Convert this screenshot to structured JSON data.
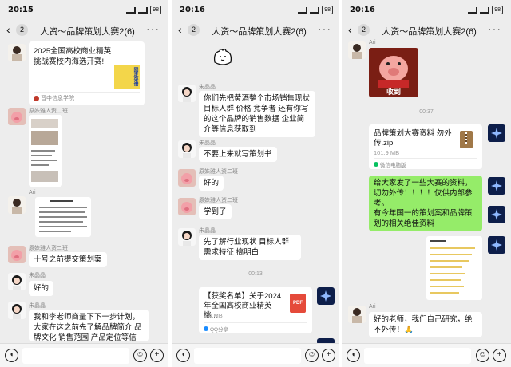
{
  "status_bar": {
    "times": [
      "20:15",
      "20:16",
      "20:16"
    ],
    "battery": "98"
  },
  "nav": {
    "back_count": "2",
    "title": "人资～品牌策划大赛2(6)"
  },
  "senders": {
    "pig": "原姝雅人资二班",
    "ai": "Ari",
    "girl": "朱晶晶"
  },
  "screen1": {
    "card": {
      "title": "2025全国高校商业精英挑战赛校内海选开赛!",
      "source": "晋中信息学院",
      "thumb_text": "固定菜谱"
    },
    "bubble1": "十号之前提交策划案",
    "bubble2": "好的",
    "bubble3": "我和李老师商量下下一步计划，大家在这之前先了解品牌简介 品牌文化 销售范围 产品定位等信息，"
  },
  "screen2": {
    "bubble1": "你们先把黄酒整个市场销售现状 目标人群 价格 竞争者 还有你写的这个品牌的销售数据 企业简介等信息获取到",
    "bubble2": "不要上来就写策划书",
    "bubble3": "好的",
    "bubble4": "学到了",
    "bubble5": "先了解行业现状 目标人群 需求特征 搞明白",
    "timestamp": "00:13",
    "file": {
      "title": "【获奖名单】关于2024年全国高校商业精英挑...",
      "size": "1.4 MB",
      "source": "QQ分享",
      "icon_text": "PDF"
    }
  },
  "screen3": {
    "sticker_caption": "收到",
    "timestamp": "00:37",
    "file": {
      "title": "品牌策划大赛资料 勿外传.zip",
      "size": "101.9 MB",
      "source": "微信电脑版"
    },
    "bubble1": "给大家发了一些大赛的资料，切勿外传！！！！仅供内部参考。",
    "bubble2": "有今年国一的策划案和品牌策划的相关绝佳资料",
    "bubble3": "好的老师，我们自己研究，绝不外传！",
    "emoji": "🙏"
  },
  "icons": {
    "back": "chevron-left-icon",
    "more": "more-icon",
    "voice": "voice-icon",
    "emoji": "emoji-icon",
    "plus": "plus-icon"
  }
}
